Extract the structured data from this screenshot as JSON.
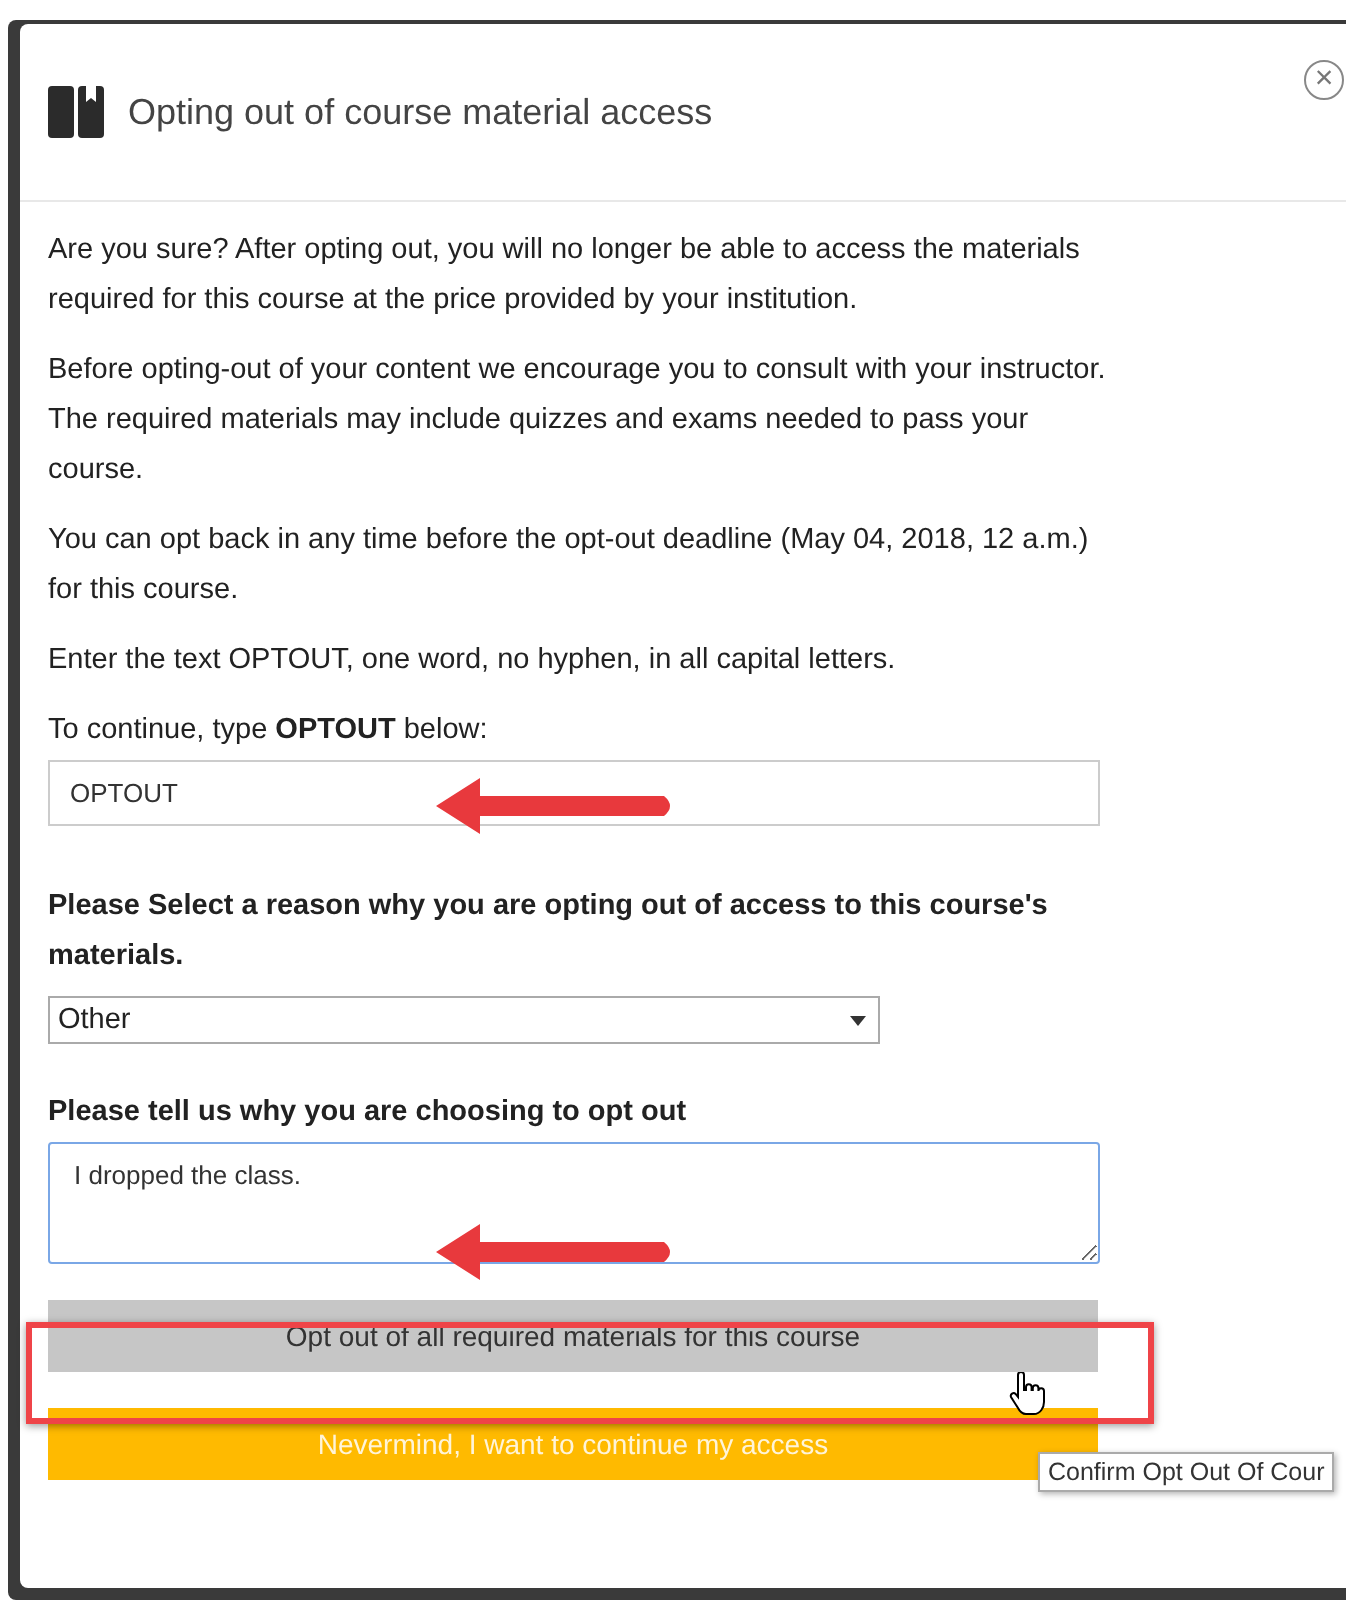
{
  "dialog": {
    "title": "Opting out of course material access",
    "close": "×"
  },
  "paragraphs": [
    "Are you sure? After opting out, you will no longer be able to access the materials required for this course at the price provided by your institution.",
    "Before opting-out of your content we encourage you to consult with your instructor. The required materials may include quizzes and exams needed to pass your course.",
    "You can opt back in any time before the opt-out deadline (May 04, 2018, 12 a.m.) for this course.",
    "Enter the text OPTOUT, one word, no hyphen, in all capital letters."
  ],
  "confirm_field": {
    "label": "To continue, type **OPTOUT** below:",
    "value": "OPTOUT"
  },
  "reason_select": {
    "label": "Please Select a reason why you are opting out of access to this course's materials.",
    "value": "Other"
  },
  "reason_text": {
    "label": "Please tell us why you are choosing to opt out",
    "value": "I dropped the class."
  },
  "buttons": [
    {
      "label": "Opt out of all required materials for this course",
      "kind": "secondary"
    },
    {
      "label": "Nevermind, I want to continue my access",
      "kind": "primary"
    }
  ],
  "tooltip": "Confirm Opt Out Of Cour"
}
